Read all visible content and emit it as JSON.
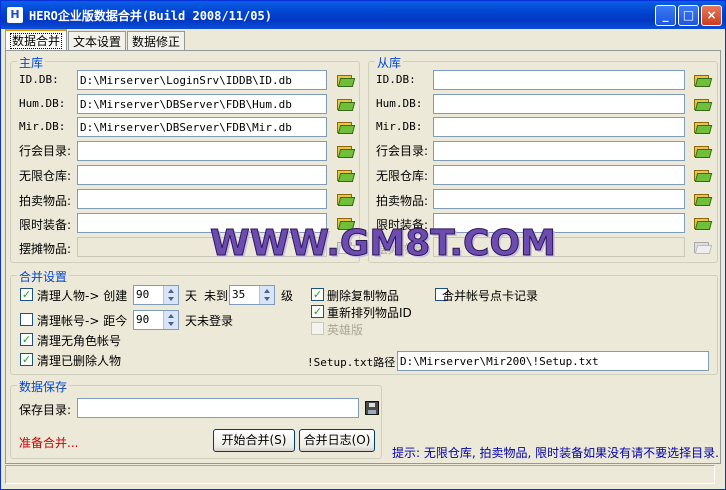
{
  "window": {
    "title": "HERO企业版数据合并(Build 2008/11/05)",
    "minimize": "_",
    "maximize": "□",
    "close": "×"
  },
  "tabs": [
    "数据合并",
    "文本设置",
    "数据修正"
  ],
  "main_db": {
    "legend": "主库",
    "rows": [
      {
        "label": "ID.DB:",
        "value": "D:\\Mirserver\\LoginSrv\\IDDB\\ID.db"
      },
      {
        "label": "Hum.DB:",
        "value": "D:\\Mirserver\\DBServer\\FDB\\Hum.db"
      },
      {
        "label": "Mir.DB:",
        "value": "D:\\Mirserver\\DBServer\\FDB\\Mir.db"
      },
      {
        "label": "行会目录:",
        "value": ""
      },
      {
        "label": "无限仓库:",
        "value": ""
      },
      {
        "label": "拍卖物品:",
        "value": ""
      },
      {
        "label": "限时装备:",
        "value": ""
      },
      {
        "label": "摆摊物品:",
        "value": ""
      }
    ]
  },
  "slave_db": {
    "legend": "从库",
    "rows": [
      {
        "label": "ID.DB:",
        "value": ""
      },
      {
        "label": "Hum.DB:",
        "value": ""
      },
      {
        "label": "Mir.DB:",
        "value": ""
      },
      {
        "label": "行会目录:",
        "value": ""
      },
      {
        "label": "无限仓库:",
        "value": ""
      },
      {
        "label": "拍卖物品:",
        "value": ""
      },
      {
        "label": "限时装备:",
        "value": ""
      },
      {
        "label": "摆摊物品:",
        "value": ""
      }
    ]
  },
  "merge": {
    "legend": "合并设置",
    "clean_char": {
      "checked": true,
      "label": "清理人物-> 创建",
      "days": "90",
      "unit1": "天",
      "mid": "未到",
      "level": "35",
      "unit2": "级"
    },
    "clean_acct": {
      "checked": false,
      "label": "清理帐号-> 距今",
      "days": "90",
      "unit": "天未登录"
    },
    "clean_norole": {
      "checked": true,
      "label": "清理无角色帐号"
    },
    "clean_deleted": {
      "checked": true,
      "label": "清理已删除人物"
    },
    "del_dup": {
      "checked": true,
      "label": "删除复制物品"
    },
    "renum": {
      "checked": true,
      "label": "重新排列物品ID"
    },
    "hero": {
      "checked": false,
      "label": "英雄版",
      "disabled": true
    },
    "merge_card": {
      "checked": false,
      "label": "合并帐号点卡记录"
    },
    "setup_label": "!Setup.txt路径:",
    "setup_value": "D:\\Mirserver\\Mir200\\!Setup.txt"
  },
  "save": {
    "legend": "数据保存",
    "dir_label": "保存目录:",
    "dir_value": "",
    "status": "准备合并...",
    "start_button": "开始合并(S)",
    "log_button": "合并日志(O)"
  },
  "hint": "提示: 无限仓库, 拍卖物品, 限时装备如果没有请不要选择目录.",
  "watermark": "WWW.GM8T.COM"
}
